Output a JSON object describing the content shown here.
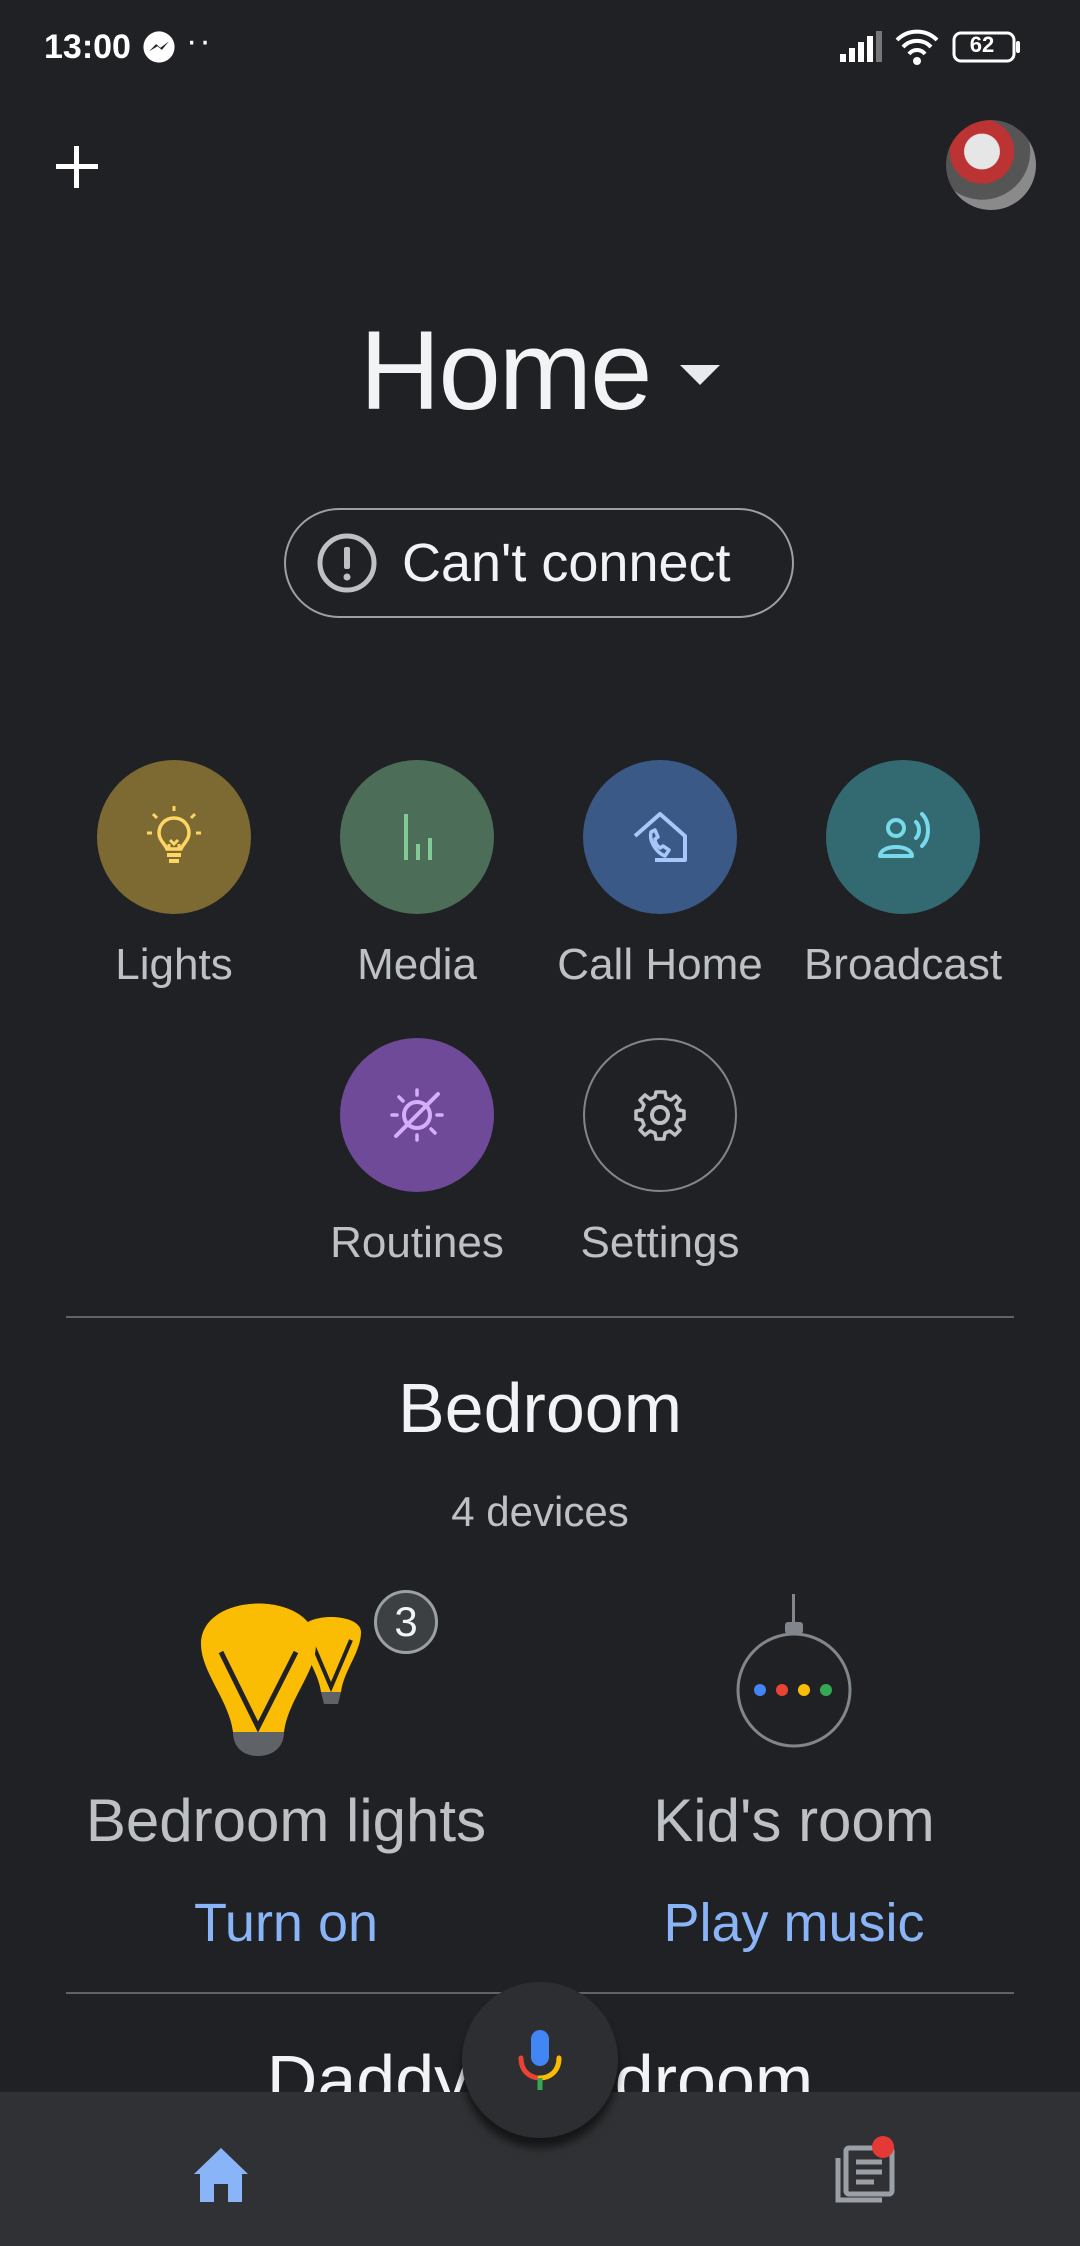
{
  "status_bar": {
    "time": "13:00",
    "dots": "··",
    "battery": "62",
    "icons": [
      "messenger-icon",
      "signal-icon",
      "wifi-icon",
      "battery-icon"
    ]
  },
  "header": {
    "add_icon": "plus-icon",
    "avatar": "profile-avatar"
  },
  "home": {
    "title": "Home",
    "status_label": "Can't connect"
  },
  "actions": [
    {
      "label": "Lights",
      "icon": "lightbulb-icon",
      "color": "#7c6a32"
    },
    {
      "label": "Media",
      "icon": "equalizer-icon",
      "color": "#4c6d57"
    },
    {
      "label": "Call Home",
      "icon": "call-home-icon",
      "color": "#3b5987"
    },
    {
      "label": "Broadcast",
      "icon": "broadcast-icon",
      "color": "#336970"
    },
    {
      "label": "Routines",
      "icon": "routines-icon",
      "color": "#6f4a98"
    },
    {
      "label": "Settings",
      "icon": "gear-icon",
      "color": "#202124"
    }
  ],
  "room": {
    "name": "Bedroom",
    "device_count": "4 devices",
    "devices": [
      {
        "name": "Bedroom lights",
        "action": "Turn on",
        "badge": "3",
        "icon": "lightbulbs-icon"
      },
      {
        "name": "Kid's room",
        "action": "Play music",
        "icon": "google-home-mini-icon"
      }
    ]
  },
  "next_room": {
    "name": "Daddy's bedroom"
  },
  "colors": {
    "background": "#202124",
    "accent": "#8ab4f8",
    "nav": "#303134"
  }
}
